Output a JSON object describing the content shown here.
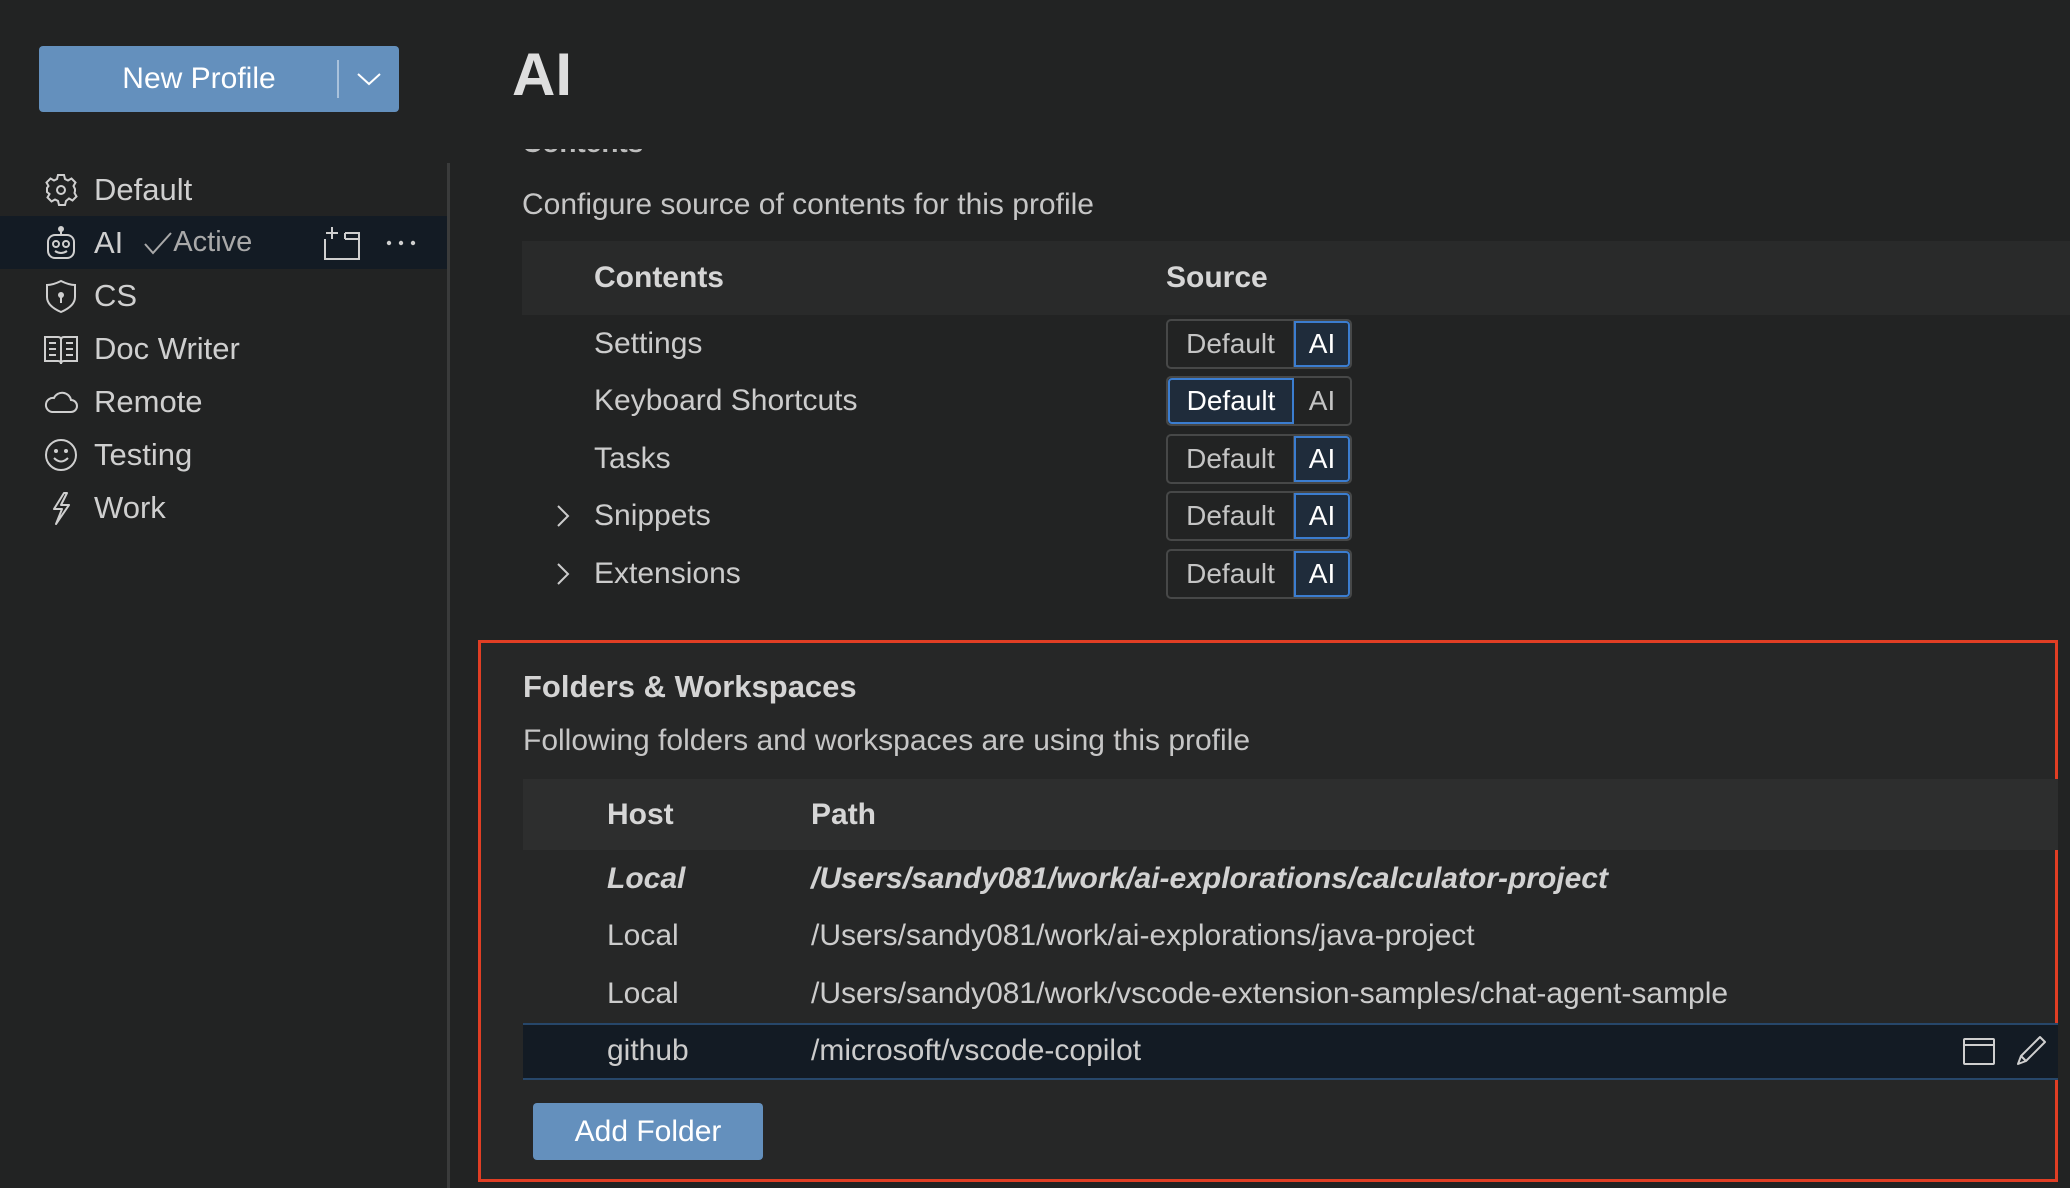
{
  "sidebar": {
    "new_profile_label": "New Profile",
    "profiles": [
      {
        "label": "Default",
        "icon": "gear-icon"
      },
      {
        "label": "AI",
        "icon": "robot-icon",
        "active": true,
        "active_label": "Active"
      },
      {
        "label": "CS",
        "icon": "shield-icon"
      },
      {
        "label": "Doc Writer",
        "icon": "book-icon"
      },
      {
        "label": "Remote",
        "icon": "cloud-icon"
      },
      {
        "label": "Testing",
        "icon": "smiley-icon"
      },
      {
        "label": "Work",
        "icon": "lightning-icon"
      }
    ]
  },
  "main": {
    "title": "AI",
    "cut_heading": "Contents",
    "contents": {
      "description": "Configure source of contents for this profile",
      "headers": [
        "Contents",
        "Source"
      ],
      "options": [
        "Default",
        "AI"
      ],
      "rows": [
        {
          "label": "Settings",
          "expandable": false,
          "selected": "AI"
        },
        {
          "label": "Keyboard Shortcuts",
          "expandable": false,
          "selected": "Default"
        },
        {
          "label": "Tasks",
          "expandable": false,
          "selected": "AI"
        },
        {
          "label": "Snippets",
          "expandable": true,
          "selected": "AI"
        },
        {
          "label": "Extensions",
          "expandable": true,
          "selected": "AI"
        }
      ]
    },
    "folders": {
      "title": "Folders & Workspaces",
      "description": "Following folders and workspaces are using this profile",
      "headers": [
        "Host",
        "Path"
      ],
      "rows": [
        {
          "host": "Local",
          "path": "/Users/sandy081/work/ai-explorations/calculator-project",
          "current": true
        },
        {
          "host": "Local",
          "path": "/Users/sandy081/work/ai-explorations/java-project"
        },
        {
          "host": "Local",
          "path": "/Users/sandy081/work/vscode-extension-samples/chat-agent-sample"
        },
        {
          "host": "github",
          "path": "/microsoft/vscode-copilot",
          "selected": true
        }
      ],
      "add_folder_label": "Add Folder"
    }
  },
  "colors": {
    "accent_button": "#6490bd",
    "selection_border": "#3b7dd0",
    "highlight_box": "#e03e24",
    "background": "#222323"
  }
}
